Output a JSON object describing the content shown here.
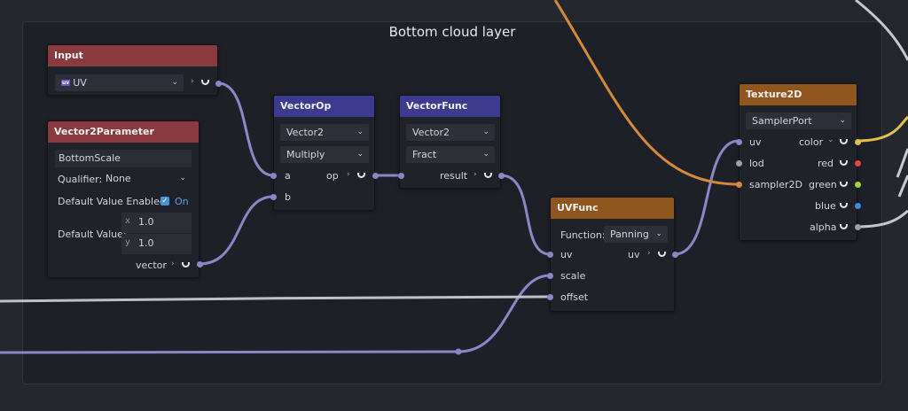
{
  "group": {
    "title": "Bottom cloud layer"
  },
  "input_node": {
    "title": "Input",
    "selected": "UV",
    "badge": "uv"
  },
  "vec2param_node": {
    "title": "Vector2Parameter",
    "name_value": "BottomScale",
    "qualifier_label": "Qualifier:",
    "qualifier_value": "None",
    "dve_label": "Default Value Enabled:",
    "dve_state": "On",
    "dv_label": "Default Value:",
    "x_label": "x",
    "x_value": "1.0",
    "y_label": "y",
    "y_value": "1.0",
    "out_label": "vector"
  },
  "vectorop_node": {
    "title": "VectorOp",
    "type_value": "Vector2",
    "op_value": "Multiply",
    "in_a": "a",
    "in_b": "b",
    "out_label": "op"
  },
  "vectorfunc_node": {
    "title": "VectorFunc",
    "type_value": "Vector2",
    "func_value": "Fract",
    "out_label": "result"
  },
  "uvfunc_node": {
    "title": "UVFunc",
    "function_label": "Function:",
    "function_value": "Panning",
    "in_uv": "uv",
    "in_scale": "scale",
    "in_offset": "offset",
    "out_label": "uv"
  },
  "texture_node": {
    "title": "Texture2D",
    "sampler_value": "SamplerPort",
    "in_uv": "uv",
    "in_lod": "lod",
    "in_sampler": "sampler2D",
    "out_color": "color",
    "out_red": "red",
    "out_green": "green",
    "out_blue": "blue",
    "out_alpha": "alpha"
  },
  "colors": {
    "wire_default": "#8e85c8",
    "wire_sampler": "#d58a3a",
    "wire_color": "#e3c04a",
    "wire_gray": "#c8c8c8",
    "header_input": "#8a3a3f",
    "header_math": "#3c3b90",
    "header_texture": "#8f561d"
  },
  "icons": {
    "dropdown": "chevron-down-icon",
    "port_out": "chevron-right-icon",
    "connected": "connected-icon",
    "check": "checkmark-icon"
  }
}
